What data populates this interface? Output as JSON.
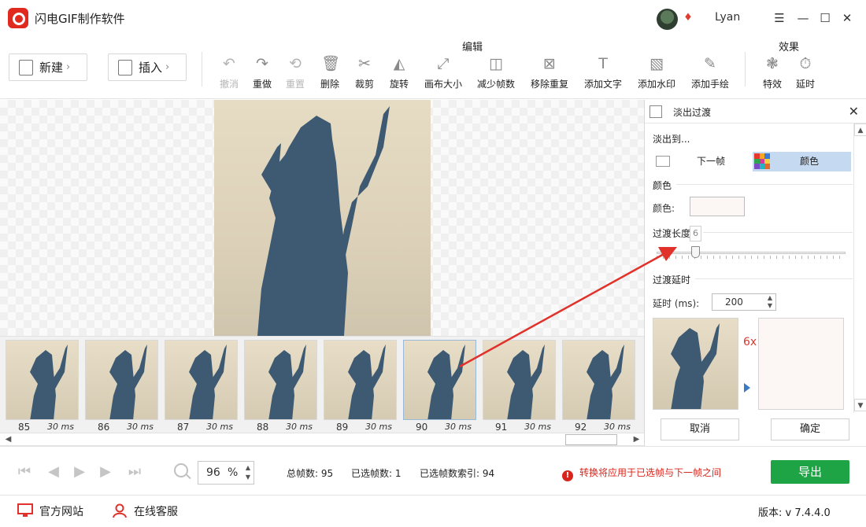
{
  "app": {
    "title": "闪电GIF制作软件",
    "username": "Lyan"
  },
  "window": {
    "menu": "☰",
    "minimize": "—",
    "maximize": "☐",
    "close": "✕"
  },
  "toolbar": {
    "new_label": "新建",
    "insert_label": "插入",
    "edit_section": "编辑",
    "effects_section": "效果",
    "tools": [
      {
        "label": "撤消",
        "icon": "undo-icon",
        "disabled": true
      },
      {
        "label": "重做",
        "icon": "redo-icon",
        "disabled": false
      },
      {
        "label": "重置",
        "icon": "reset-icon",
        "disabled": true
      },
      {
        "label": "删除",
        "icon": "delete-icon",
        "disabled": false
      },
      {
        "label": "裁剪",
        "icon": "crop-icon",
        "disabled": false
      },
      {
        "label": "旋转",
        "icon": "rotate-icon",
        "disabled": false
      },
      {
        "label": "画布大小",
        "icon": "canvas-size-icon",
        "disabled": false
      },
      {
        "label": "减少帧数",
        "icon": "reduce-frames-icon",
        "disabled": false
      },
      {
        "label": "移除重复",
        "icon": "remove-duplicates-icon",
        "disabled": false
      },
      {
        "label": "添加文字",
        "icon": "add-text-icon",
        "disabled": false
      },
      {
        "label": "添加水印",
        "icon": "add-watermark-icon",
        "disabled": false
      },
      {
        "label": "添加手绘",
        "icon": "add-drawing-icon",
        "disabled": false
      }
    ],
    "effects": [
      {
        "label": "特效",
        "icon": "effects-icon"
      },
      {
        "label": "延时",
        "icon": "delay-icon"
      }
    ]
  },
  "filmstrip": {
    "frames": [
      {
        "number": "85",
        "duration": "30 ms"
      },
      {
        "number": "86",
        "duration": "30 ms"
      },
      {
        "number": "87",
        "duration": "30 ms"
      },
      {
        "number": "88",
        "duration": "30 ms"
      },
      {
        "number": "89",
        "duration": "30 ms"
      },
      {
        "number": "90",
        "duration": "30 ms"
      },
      {
        "number": "91",
        "duration": "30 ms"
      },
      {
        "number": "92",
        "duration": "30 ms"
      }
    ]
  },
  "panel": {
    "title": "淡出过渡",
    "fade_to_label": "淡出到...",
    "option_next_frame": "下一帧",
    "option_color": "颜色",
    "color_group": "颜色",
    "color_field_label": "颜色:",
    "color_value": "#fcf7f5",
    "length_group": "过渡长度",
    "length_value": "6",
    "delay_group": "过渡延时",
    "delay_label": "延时 (ms):",
    "delay_value": "200",
    "multiplier": "6x",
    "cancel": "取消",
    "confirm": "确定"
  },
  "playback": {
    "zoom_value": "96",
    "zoom_unit": "%",
    "total_frames": "总帧数: 95",
    "selected_frames": "已选帧数: 1",
    "selected_index": "已选帧数索引: 94",
    "warning": "转换将应用于已选帧与下一帧之间",
    "export": "导出"
  },
  "statusbar": {
    "website": "官方网站",
    "support": "在线客服",
    "version": "版本: v 7.4.4.0"
  },
  "colors": {
    "accent_green": "#1ea345",
    "warning_red": "#d8261d",
    "selection_blue": "#c5d9f1"
  }
}
